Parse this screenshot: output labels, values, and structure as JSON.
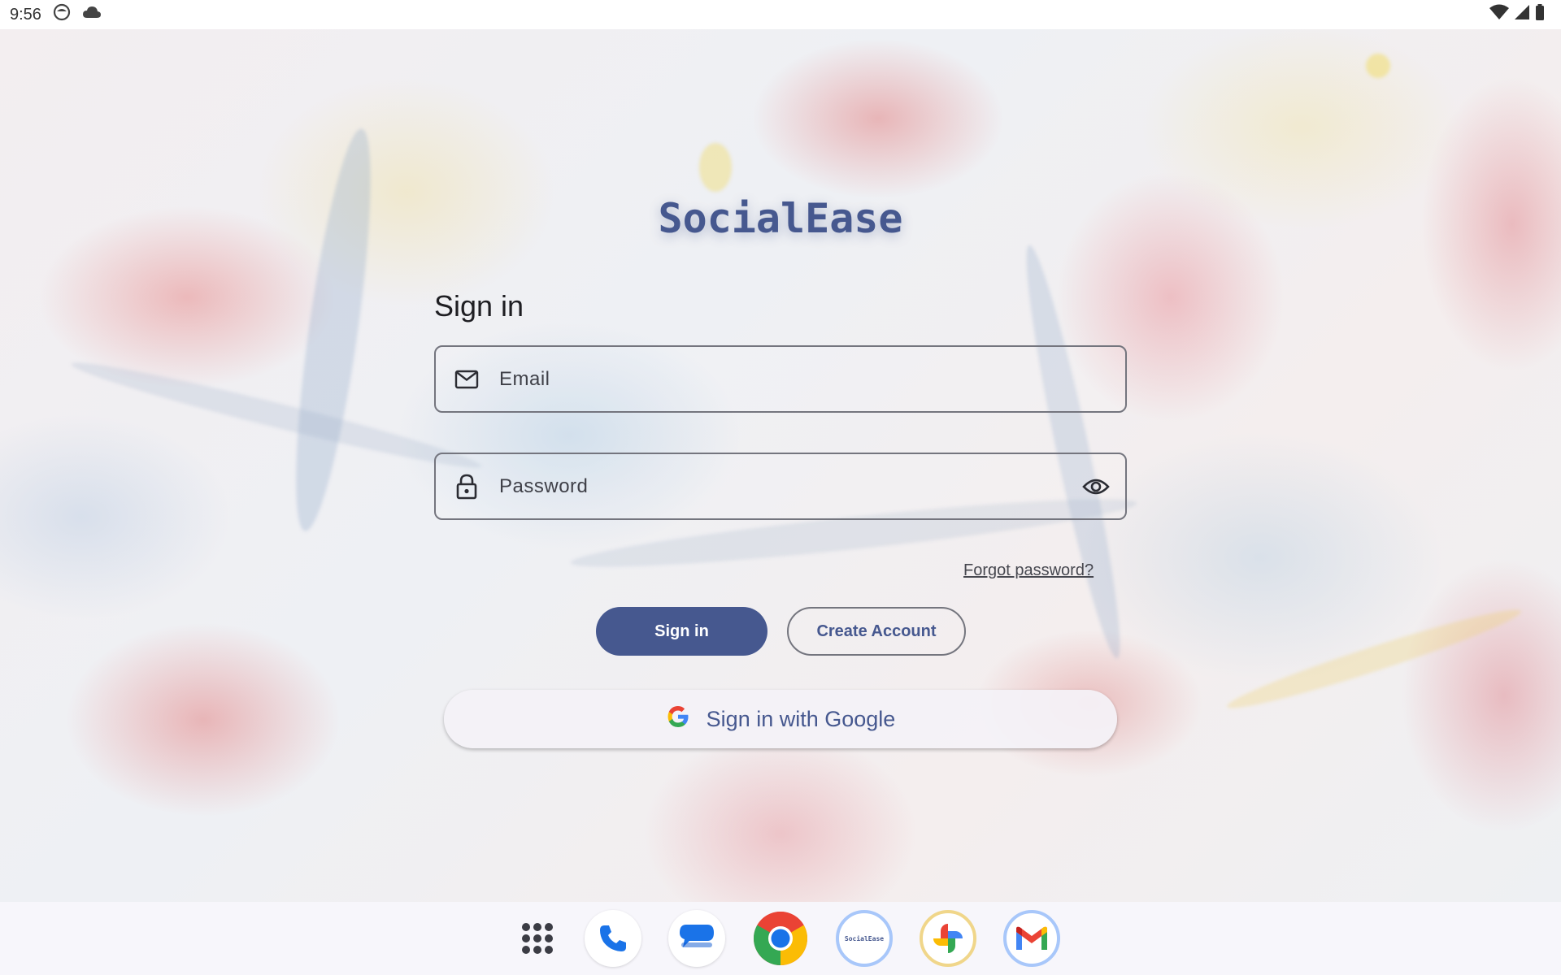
{
  "status_bar": {
    "time": "9:56",
    "left_icons": [
      "android-face-icon",
      "cloud-icon"
    ],
    "right_icons": [
      "wifi-icon",
      "signal-icon",
      "battery-icon"
    ]
  },
  "app": {
    "title": "SocialEase"
  },
  "form": {
    "heading": "Sign in",
    "email": {
      "placeholder": "Email",
      "icon": "mail-icon"
    },
    "password": {
      "placeholder": "Password",
      "icon": "lock-icon",
      "toggle_icon": "eye-icon"
    },
    "forgot_label": "Forgot password?",
    "sign_in_label": "Sign in",
    "create_account_label": "Create Account",
    "google_label": "Sign in with Google"
  },
  "dock": {
    "apps": [
      {
        "name": "apps-grid",
        "icon": "apps-grid-icon"
      },
      {
        "name": "phone",
        "icon": "phone-icon"
      },
      {
        "name": "messages",
        "icon": "messages-icon"
      },
      {
        "name": "chrome",
        "icon": "chrome-icon"
      },
      {
        "name": "socialease",
        "icon": "socialease-icon",
        "label": "SocialEase"
      },
      {
        "name": "photos",
        "icon": "photos-icon"
      },
      {
        "name": "gmail",
        "icon": "gmail-icon"
      }
    ]
  },
  "colors": {
    "primary": "#46588f",
    "outline": "#74757e",
    "text": "#1f1f23"
  }
}
